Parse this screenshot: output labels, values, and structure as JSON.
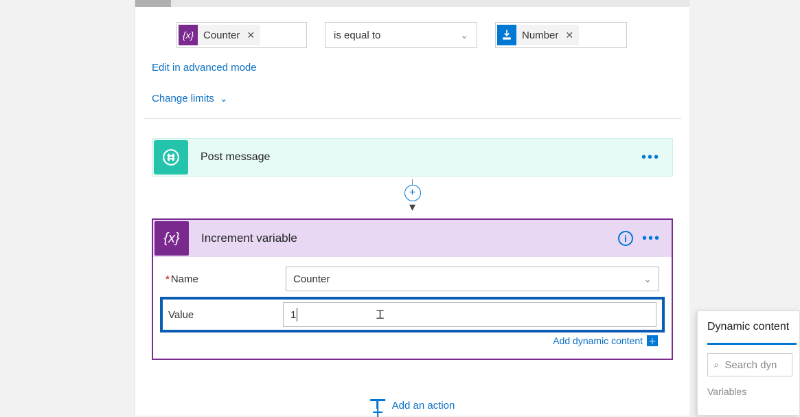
{
  "condition": {
    "left_token": {
      "icon": "variable-icon",
      "label": "Counter"
    },
    "operator": "is equal to",
    "right_token": {
      "icon": "number-icon",
      "label": "Number"
    }
  },
  "links": {
    "edit_advanced": "Edit in advanced mode",
    "change_limits": "Change limits"
  },
  "post_message": {
    "title": "Post message"
  },
  "increment": {
    "title": "Increment variable",
    "name_label": "Name",
    "name_value": "Counter",
    "value_label": "Value",
    "value_value": "1",
    "add_dynamic": "Add dynamic content"
  },
  "add_action": "Add an action",
  "dynamic_panel": {
    "title": "Dynamic content",
    "search_placeholder": "Search dyn",
    "section": "Variables"
  }
}
